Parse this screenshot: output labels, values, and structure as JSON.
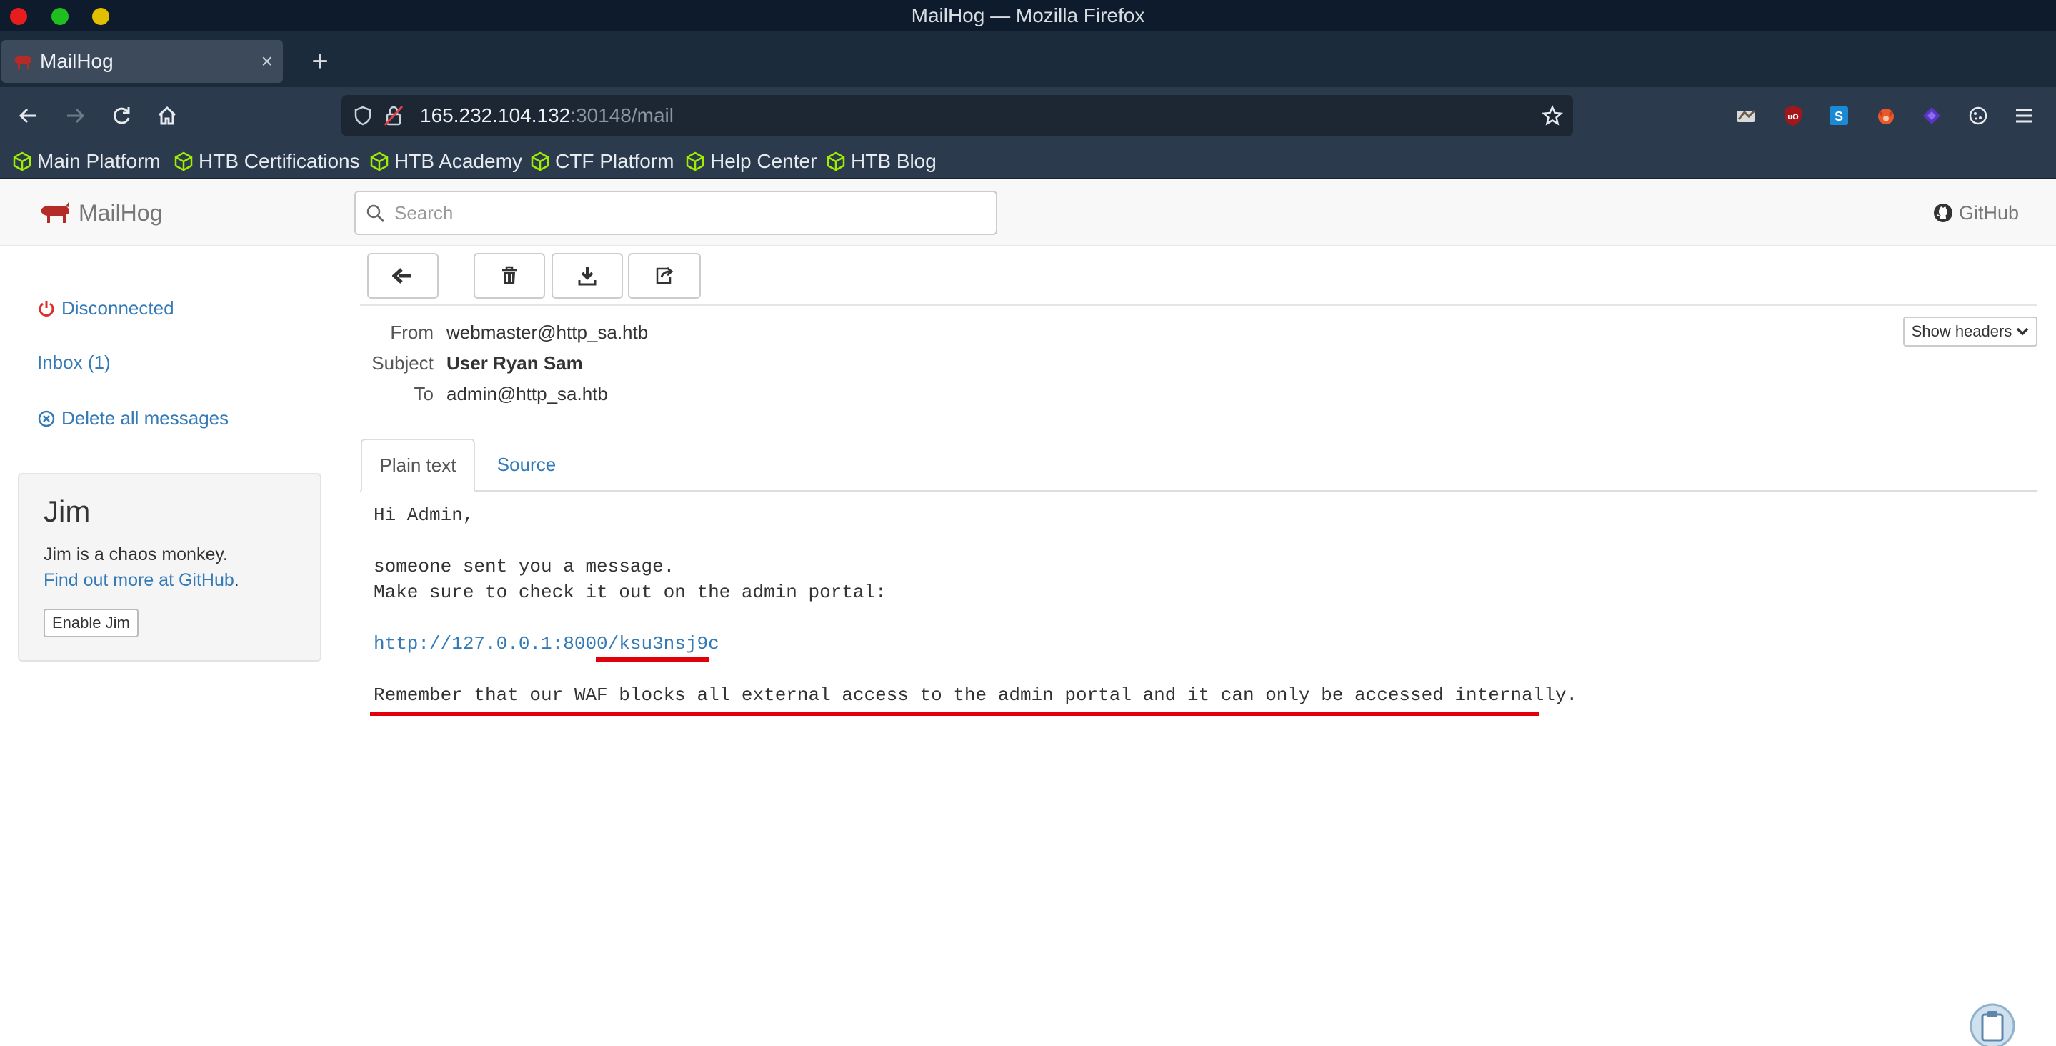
{
  "window": {
    "title": "MailHog — Mozilla Firefox"
  },
  "browser": {
    "tab": {
      "title": "MailHog",
      "close": "×"
    },
    "new_tab": "+",
    "url": {
      "host": "165.232.104.132",
      "path": ":30148/mail"
    },
    "bookmarks": [
      "Main Platform",
      "HTB Certifications",
      "HTB Academy",
      "CTF Platform",
      "Help Center",
      "HTB Blog"
    ]
  },
  "mailhog": {
    "brand": "MailHog",
    "search": {
      "placeholder": "Search"
    },
    "github": "GitHub",
    "sidebar": {
      "status": "Disconnected",
      "inbox": "Inbox (1)",
      "delete_all": "Delete all messages"
    },
    "jim": {
      "title": "Jim",
      "description": "Jim is a chaos monkey.",
      "link": "Find out more at GitHub",
      "link_suffix": ".",
      "button": "Enable Jim"
    },
    "message": {
      "from_label": "From",
      "from": "webmaster@http_sa.htb",
      "subject_label": "Subject",
      "subject": "User Ryan Sam",
      "to_label": "To",
      "to": "admin@http_sa.htb",
      "show_headers": "Show headers",
      "tabs": {
        "plain": "Plain text",
        "source": "Source"
      },
      "body": {
        "greeting": "Hi Admin,",
        "line1": "someone sent you a message.",
        "line2": "Make sure to check it out on the admin portal:",
        "link": "http://127.0.0.1:8000/ksu3nsj9c",
        "line3": "Remember that our WAF blocks all external access to the admin portal and it can only be accessed internally."
      }
    }
  },
  "colors": {
    "link": "#337ab7",
    "annotation": "#e0000a",
    "power_icon": "#d9302c",
    "htb_green": "#9fef00"
  }
}
